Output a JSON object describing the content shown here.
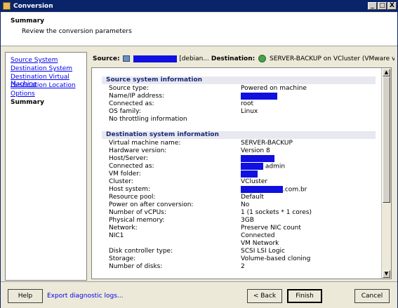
{
  "window": {
    "title": "Conversion",
    "buttons": [
      "_",
      "□",
      "X"
    ]
  },
  "header": {
    "title": "Summary",
    "subtitle": "Review the conversion parameters"
  },
  "nav": {
    "items": [
      {
        "label": "Source System",
        "active": false
      },
      {
        "label": "Destination System",
        "active": false
      },
      {
        "label": "Destination Virtual Machine",
        "active": false
      },
      {
        "label": "Destination Location",
        "active": false
      },
      {
        "label": "Options",
        "active": false
      },
      {
        "label": "Summary",
        "active": true
      }
    ]
  },
  "source_dest": {
    "source_label": "Source:",
    "source_value": "[debian...",
    "dest_label": "Destination:",
    "dest_value": "SERVER-BACKUP on VCluster (VMware vCenter Ser..."
  },
  "sections": [
    {
      "title": "Source system information",
      "rows": [
        {
          "label": "Source type:",
          "value": "Powered on machine"
        },
        {
          "label": "Name/IP address:",
          "value": "",
          "redacted": true
        },
        {
          "label": "Connected as:",
          "value": "root"
        },
        {
          "label": "OS family:",
          "value": "Linux"
        },
        {
          "label": "No throttling information",
          "value": ""
        }
      ]
    },
    {
      "title": "Destination system information",
      "rows": [
        {
          "label": "Virtual machine name:",
          "value": "SERVER-BACKUP"
        },
        {
          "label": "Hardware version:",
          "value": "Version 8"
        },
        {
          "label": "Host/Server:",
          "value": "",
          "redacted": true
        },
        {
          "label": "Connected as:",
          "value": "admin",
          "redacted": true
        },
        {
          "label": "VM folder:",
          "value": "",
          "redacted": true
        },
        {
          "label": "Cluster:",
          "value": "VCluster"
        },
        {
          "label": "Host system:",
          "value": ".com.br",
          "redacted": true
        },
        {
          "label": "Resource pool:",
          "value": "Default"
        },
        {
          "label": "Power on after conversion:",
          "value": "No"
        },
        {
          "label": "Number of vCPUs:",
          "value": "1 (1 sockets * 1 cores)"
        },
        {
          "label": "Physical memory:",
          "value": "3GB"
        },
        {
          "label": "Network:",
          "value": "Preserve NIC count"
        },
        {
          "label": "NIC1",
          "value": "Connected"
        },
        {
          "label": "",
          "value": "VM Network"
        },
        {
          "label": "Disk controller type:",
          "value": "SCSI LSI Logic"
        },
        {
          "label": "Storage:",
          "value": "Volume-based cloning"
        },
        {
          "label": "Number of disks:",
          "value": "2"
        }
      ]
    }
  ],
  "footer": {
    "help_label": "Help",
    "export_label": "Export diagnostic logs...",
    "back_label": "< Back",
    "finish_label": "Finish",
    "cancel_label": "Cancel"
  }
}
